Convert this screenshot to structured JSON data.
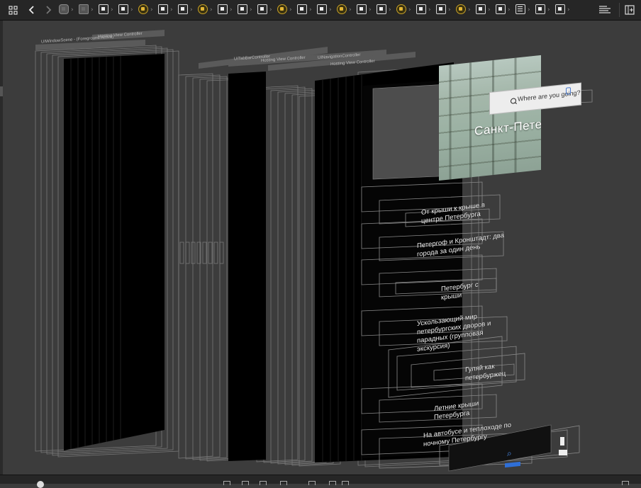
{
  "toolbar": {
    "grid_icon": "grid-icon",
    "back_icon": "chevron-left-icon",
    "forward_icon": "chevron-right-icon",
    "add_editor_icon": "add-editor-icon",
    "editor_options_icon": "lines-icon"
  },
  "scene": {
    "window_labels": [
      "UIWindowScene - (Foreground Active)",
      "Hosting View Controller",
      "UITabBarController",
      "Hosting View Controller",
      "UINavigationController",
      "Hosting View Controller"
    ],
    "hero_title": "Санкт-Петербург",
    "search_placeholder": "Where are you going?",
    "rows": [
      "От крыши к крыше в центре Петербурга",
      "Петергоф и Кронштадт: два города за один день",
      "Петербург с крыши",
      "Ускользающий мир петербургских дворов и парадных (групповая экскурсия)",
      "Гуляй как петербуржец",
      "Летние крыши Петербурга",
      "На автобусе и теплоходе по ночному Петербургу"
    ]
  },
  "colors": {
    "background": "#3c3c3c",
    "toolbar": "#262626",
    "accent_yellow": "#e2b636",
    "tab_blue": "#2f6fd6"
  }
}
